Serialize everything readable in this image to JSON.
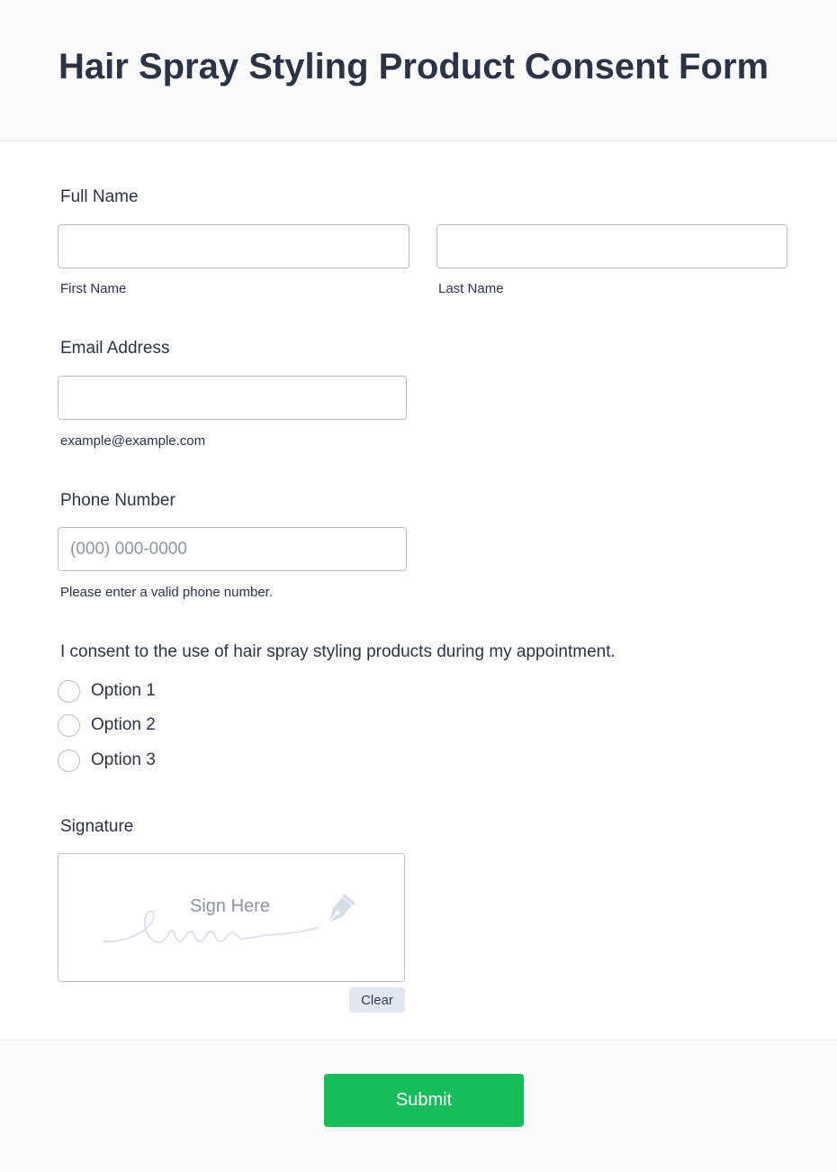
{
  "form": {
    "title": "Hair Spray Styling Product Consent Form"
  },
  "full_name": {
    "label": "Full Name",
    "first_sublabel": "First Name",
    "last_sublabel": "Last Name",
    "first_value": "",
    "last_value": ""
  },
  "email": {
    "label": "Email Address",
    "value": "",
    "sublabel": "example@example.com"
  },
  "phone": {
    "label": "Phone Number",
    "placeholder": "(000) 000-0000",
    "value": "",
    "sublabel": "Please enter a valid phone number."
  },
  "consent": {
    "question": "I consent to the use of hair spray styling products during my appointment.",
    "options": [
      {
        "label": "Option 1",
        "selected": false
      },
      {
        "label": "Option 2",
        "selected": false
      },
      {
        "label": "Option 3",
        "selected": false
      }
    ]
  },
  "signature": {
    "label": "Signature",
    "hint": "Sign Here",
    "clear_label": "Clear",
    "hint_icon": "fountain-pen-icon"
  },
  "submit": {
    "label": "Submit",
    "color": "#18bd5b"
  }
}
